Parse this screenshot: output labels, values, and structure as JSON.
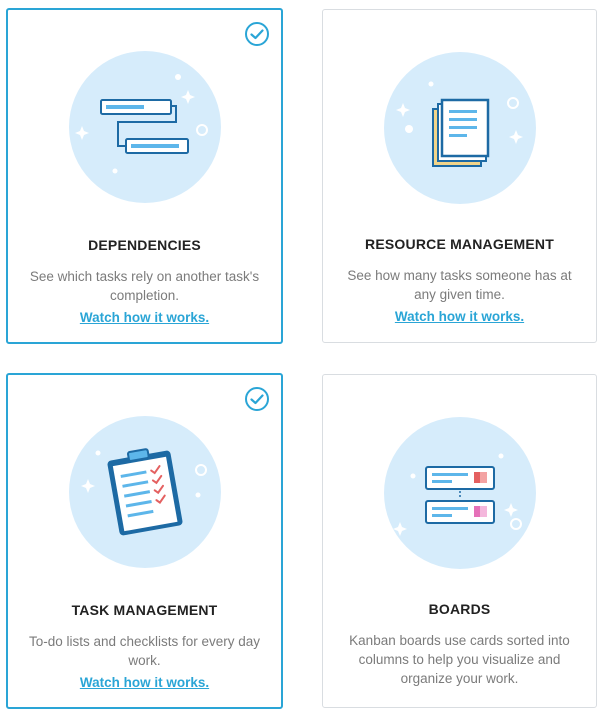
{
  "colors": {
    "accent": "#2aa5d6",
    "circle": "#d6ecfb",
    "border": "#d9dde1",
    "text_muted": "#7b7b7b",
    "icon_red": "#e46060",
    "icon_pink": "#e570b8",
    "icon_yellow": "#f2d58a"
  },
  "cards": [
    {
      "title": "DEPENDENCIES",
      "description": "See which tasks rely on another task's completion.",
      "link": "Watch how it works.",
      "selected": true,
      "icon": "dependencies-icon"
    },
    {
      "title": "RESOURCE MANAGEMENT",
      "description": "See how many tasks someone has at any given time.",
      "link": "Watch how it works.",
      "selected": false,
      "icon": "resource-management-icon"
    },
    {
      "title": "TASK MANAGEMENT",
      "description": "To-do lists and checklists for every day work.",
      "link": "Watch how it works.",
      "selected": true,
      "icon": "task-management-icon"
    },
    {
      "title": "BOARDS",
      "description": "Kanban boards use cards sorted into columns to help you visualize and organize your work.",
      "selected": false,
      "icon": "boards-icon"
    }
  ]
}
